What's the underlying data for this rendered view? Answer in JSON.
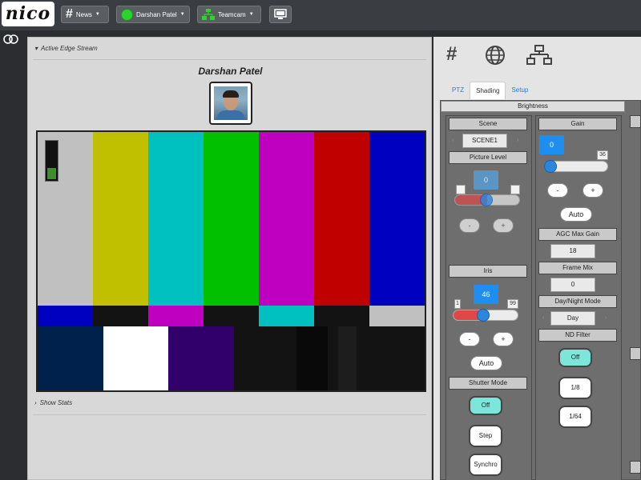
{
  "nav": {
    "logo": "nico",
    "news_label": "News",
    "user_label": "Darshan Patel",
    "team_label": "Teamcam"
  },
  "left": {
    "stream_header": "Active Edge Stream",
    "user_name": "Darshan Patel",
    "stats_header": "Show Stats",
    "audio_level": 0.3,
    "colorbars": {
      "row1": [
        "#c0c0c0",
        "#c0c000",
        "#00c0c0",
        "#00c000",
        "#c000c0",
        "#c00000",
        "#0000c0"
      ],
      "row2": [
        "#0000c0",
        "#131313",
        "#c000c0",
        "#131313",
        "#00c0c0",
        "#131313",
        "#c0c0c0"
      ],
      "row3": [
        "#00214c",
        "#ffffff",
        "#32006a",
        "#131313",
        "#090909",
        "#131313",
        "#1d1d1d",
        "#131313"
      ]
    }
  },
  "right": {
    "icons": [
      "hash-icon",
      "globe-icon",
      "network-icon"
    ],
    "tabs": [
      "PTZ",
      "Shading",
      "Setup"
    ],
    "active_tab": "Shading",
    "brightness_title": "Brightness",
    "scene": {
      "label": "Scene",
      "value": "SCENE1"
    },
    "picture_level": {
      "label": "Picture Level",
      "value": "0"
    },
    "iris": {
      "label": "Iris",
      "value": "46",
      "min": "1",
      "max": "99",
      "level": 0.46
    },
    "shutter_mode": {
      "label": "Shutter Mode",
      "options": [
        "Off",
        "Step",
        "Synchro"
      ],
      "selected": "Off"
    },
    "gain": {
      "label": "Gain",
      "value": "0",
      "max": "36",
      "level": 0.0
    },
    "agc_max_gain": {
      "label": "AGC Max Gain",
      "value": "18"
    },
    "frame_mix": {
      "label": "Frame Mix",
      "value": "0"
    },
    "day_night": {
      "label": "Day/Night Mode",
      "value": "Day"
    },
    "nd_filter": {
      "label": "ND Filter",
      "options": [
        "Off",
        "1/8",
        "1/64"
      ],
      "selected": "Off"
    },
    "minus": "-",
    "plus": "+",
    "auto": "Auto",
    "colors": {
      "accent_blue": "#1e8ff0",
      "active_green": "#7de6da",
      "slider_red": "#e04848"
    }
  }
}
